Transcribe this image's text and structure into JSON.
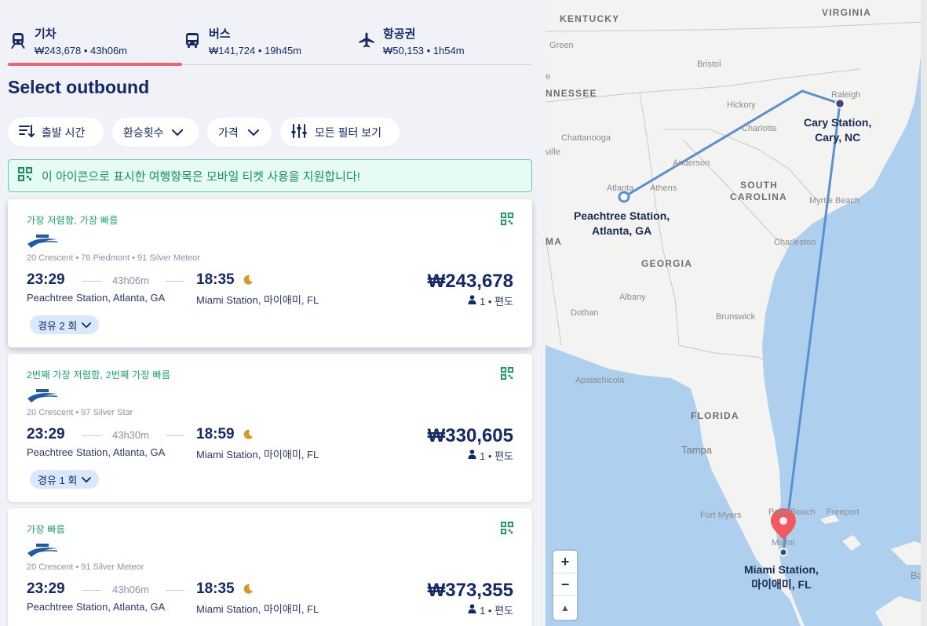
{
  "tabs": [
    {
      "name": "기차",
      "sub": "₩243,678 • 43h06m",
      "icon": "train-icon",
      "active": true
    },
    {
      "name": "버스",
      "sub": "₩141,724 • 19h45m",
      "icon": "bus-icon",
      "active": false
    },
    {
      "name": "항공권",
      "sub": "₩50,153 • 1h54m",
      "icon": "plane-icon",
      "active": false
    }
  ],
  "page_title": "Select outbound",
  "filters": {
    "departure_time": "출발 시간",
    "transfers": "환승횟수",
    "price": "가격",
    "all_filters": "모든 필터 보기"
  },
  "banner": {
    "text": "이 아이콘으로 표시한 여행항목은 모바일 티켓 사용을 지원합니다!",
    "icon": "qr-code-icon"
  },
  "results": [
    {
      "tag": "가장 저렴함, 가장 빠름",
      "trains": "20 Crescent • 76 Piedmont • 91 Silver Meteor",
      "dep_time": "23:29",
      "duration": "43h06m",
      "arr_time": "18:35",
      "from": "Peachtree Station, Atlanta, GA",
      "to": "Miami Station, 마이애미, FL",
      "price": "₩243,678",
      "pax": "1 • 편도",
      "stops": "경유 2 회"
    },
    {
      "tag": "2번째 가장 저렴함, 2번째 가장 빠름",
      "trains": "20 Crescent • 97 Silver Star",
      "dep_time": "23:29",
      "duration": "43h30m",
      "arr_time": "18:59",
      "from": "Peachtree Station, Atlanta, GA",
      "to": "Miami Station, 마이애미, FL",
      "price": "₩330,605",
      "pax": "1 • 편도",
      "stops": "경유 1 회"
    },
    {
      "tag": "가장 빠름",
      "trains": "20 Crescent • 91 Silver Meteor",
      "dep_time": "23:29",
      "duration": "43h06m",
      "arr_time": "18:35",
      "from": "Peachtree Station, Atlanta, GA",
      "to": "Miami Station, 마이애미, FL",
      "price": "₩373,355",
      "pax": "1 • 편도",
      "stops": ""
    }
  ],
  "map": {
    "states": [
      "KENTUCKY",
      "VIRGINIA",
      "NNESSEE",
      "SOUTH",
      "CAROLINA",
      "GEORGIA",
      "FLORIDA",
      "MA"
    ],
    "cities": [
      "Green",
      "Bristol",
      "Hickory",
      "Charlotte",
      "Raleigh",
      "Chattanooga",
      "ville",
      "Anderson",
      "Atlanta",
      "Athens",
      "Myrtle Beach",
      "Charleston",
      "Albany",
      "Brunswick",
      "Dothan",
      "Apalachicola",
      "Tampa",
      "Fort Myers",
      "Palm Beach",
      "Freeport",
      "Miami",
      "Bah",
      "e"
    ],
    "stations": {
      "atlanta": [
        "Peachtree Station,",
        "Atlanta, GA"
      ],
      "cary": [
        "Cary Station,",
        "Cary, NC"
      ],
      "miami": [
        "Miami Station,",
        "마이애미, FL"
      ]
    },
    "zoom_in": "+",
    "zoom_out": "−",
    "compass": "▲",
    "route_color": "#5a8fd0",
    "pin_color": "#f25a5f"
  }
}
